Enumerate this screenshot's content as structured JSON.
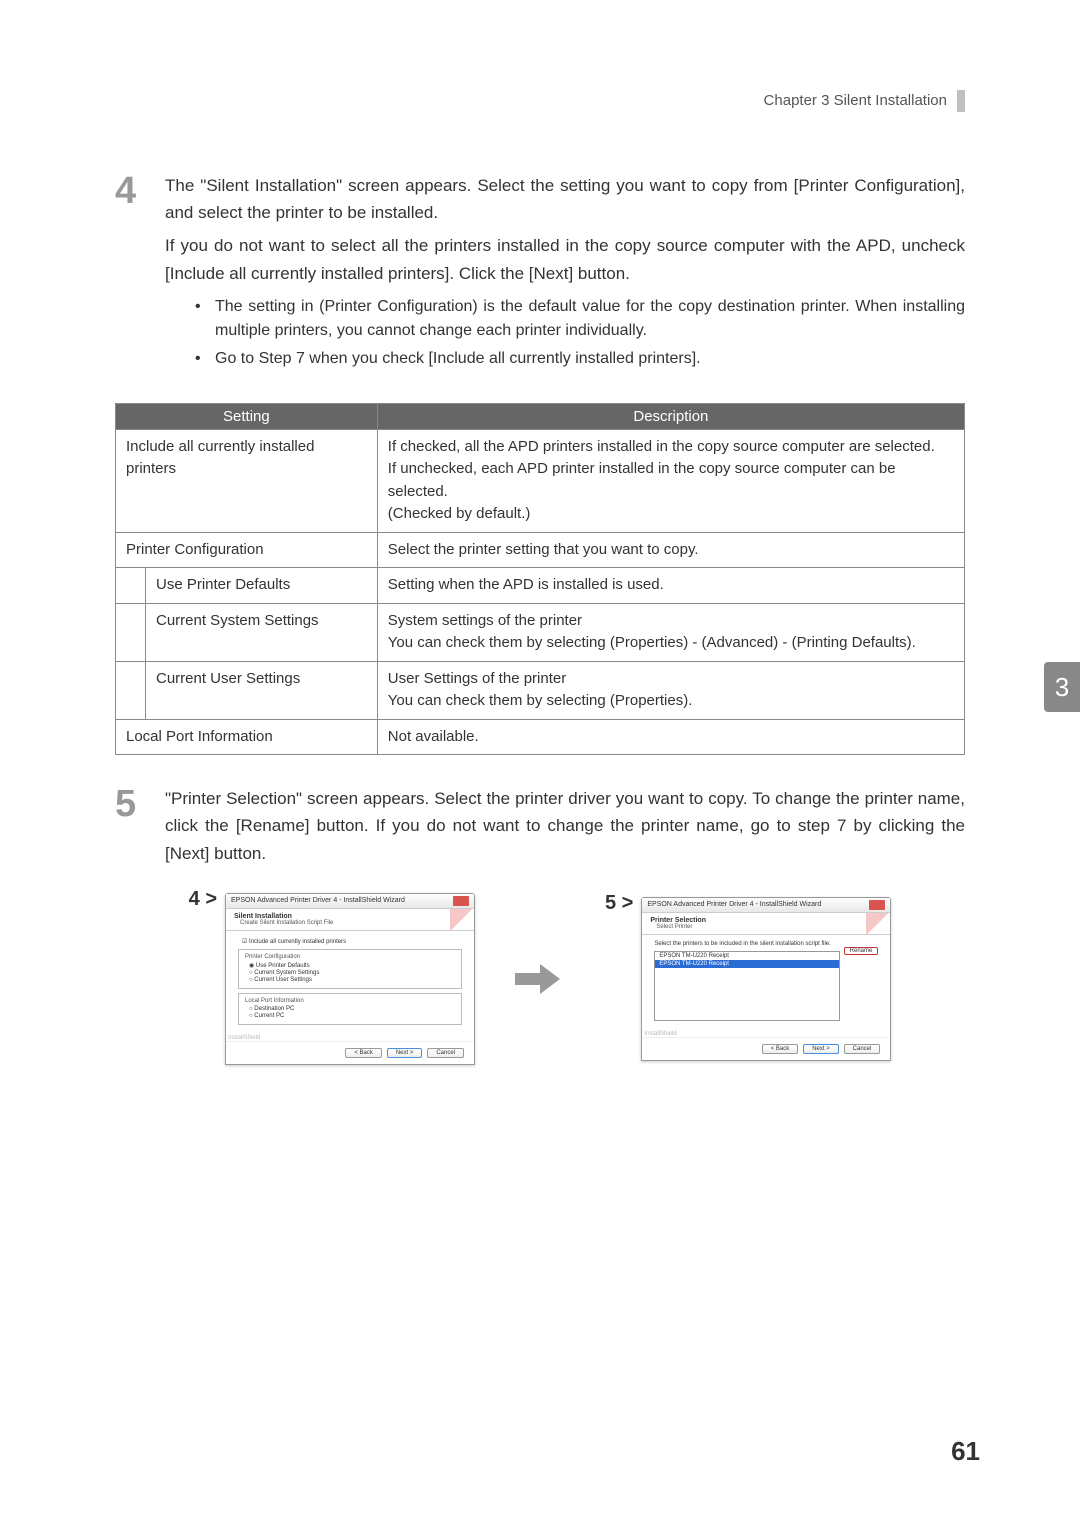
{
  "chapter": "Chapter 3   Silent Installation",
  "step4": {
    "num": "4",
    "p1": "The \"Silent Installation\" screen appears. Select the setting you want to copy from [Printer Configuration], and select the printer to be installed.",
    "p2": "If you do not want to select all the printers installed in the copy source computer with the APD, uncheck [Include all currently installed printers]. Click the [Next] button.",
    "b1": "The setting in (Printer Configuration) is the default value for the copy destination printer. When installing multiple printers, you cannot change each printer individually.",
    "b2": "Go to Step 7 when you check [Include all currently installed printers]."
  },
  "table": {
    "h1": "Setting",
    "h2": "Description",
    "rows": [
      {
        "s": "Include all currently installed printers",
        "d": "If checked, all the APD printers installed in the copy source computer are selected.\nIf unchecked, each APD printer installed in the copy source computer can be selected.\n(Checked by default.)"
      },
      {
        "s": "Printer Configuration",
        "d": "Select the printer setting that you want to copy."
      },
      {
        "s": "Use Printer Defaults",
        "d": "Setting when the APD is installed is used.",
        "indent": true
      },
      {
        "s": "Current System Settings",
        "d": "System settings of the printer\nYou can check them by selecting (Properties) - (Advanced) - (Printing Defaults).",
        "indent": true
      },
      {
        "s": "Current User Settings",
        "d": "User Settings of the printer\nYou can check them by selecting (Properties).",
        "indent": true
      },
      {
        "s": "Local Port Information",
        "d": "Not available."
      }
    ]
  },
  "step5": {
    "num": "5",
    "p1": "\"Printer Selection\" screen appears. Select the printer driver you want to copy. To change the printer name, click the [Rename] button. If you do not want to change the printer name, go to step 7 by clicking the [Next] button."
  },
  "shots": {
    "label4": "4 >",
    "label5": "5 >",
    "dlg4": {
      "title": "EPSON Advanced Printer Driver 4 - InstallShield Wizard",
      "heading": "Silent Installation",
      "sub": "Create Silent Installation Script File",
      "check": "Include all currently installed printers",
      "group1": "Printer Configuration",
      "r1": "Use Printer Defaults",
      "r2": "Current System Settings",
      "r3": "Current User Settings",
      "group2": "Local Port Information",
      "r4": "Destination PC",
      "r5": "Current PC",
      "back": "< Back",
      "next": "Next >",
      "cancel": "Cancel"
    },
    "dlg5": {
      "title": "EPSON Advanced Printer Driver 4 - InstallShield Wizard",
      "heading": "Printer Selection",
      "sub": "Select Printer",
      "instr": "Select the printers to be included in the silent installation script file.",
      "item1": "EPSON TM-U220 Receipt",
      "item2": "EPSON TM-U220 Receipt",
      "rename": "Rename",
      "back": "< Back",
      "next": "Next >",
      "cancel": "Cancel"
    },
    "ishield": "InstallShield"
  },
  "sideTab": "3",
  "pageNum": "61"
}
